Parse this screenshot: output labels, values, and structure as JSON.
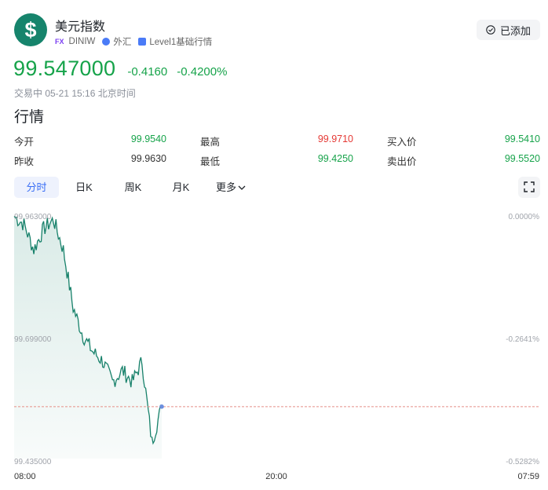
{
  "header": {
    "title": "美元指数",
    "market_tag": "FX",
    "symbol": "DINIW",
    "category": "外汇",
    "level": "Level1基础行情",
    "added_label": "已添加"
  },
  "quote": {
    "price": "99.547000",
    "change": "-0.4160",
    "change_pct": "-0.4200%",
    "status": "交易中 05-21 15:16 北京时间"
  },
  "section_title": "行情",
  "stats": {
    "open_label": "今开",
    "open": "99.9540",
    "high_label": "最高",
    "high": "99.9710",
    "bid_label": "买入价",
    "bid": "99.5410",
    "prev_close_label": "昨收",
    "prev_close": "99.9630",
    "low_label": "最低",
    "low": "99.4250",
    "ask_label": "卖出价",
    "ask": "99.5520"
  },
  "tabs": [
    {
      "label": "分时",
      "active": true
    },
    {
      "label": "日K",
      "active": false
    },
    {
      "label": "周K",
      "active": false
    },
    {
      "label": "月K",
      "active": false
    },
    {
      "label": "更多",
      "active": false
    }
  ],
  "chart_data": {
    "type": "area",
    "y_labels_left": [
      "99.963000",
      "99.699000",
      "99.435000"
    ],
    "y_labels_right": [
      "0.0000%",
      "-0.2641%",
      "-0.5282%"
    ],
    "x_labels": [
      "08:00",
      "20:00",
      "07:59"
    ],
    "ylim": [
      99.435,
      99.963
    ],
    "reference_line": 99.547,
    "line_color": "#17816a",
    "x": [
      "08:00",
      "08:30",
      "09:00",
      "09:30",
      "10:00",
      "10:30",
      "11:00",
      "11:30",
      "12:00",
      "12:30",
      "13:00",
      "13:30",
      "14:00",
      "14:30",
      "15:00",
      "15:16"
    ],
    "values": [
      99.957,
      99.94,
      99.885,
      99.93,
      99.95,
      99.885,
      99.76,
      99.7,
      99.665,
      99.645,
      99.6,
      99.625,
      99.6,
      99.645,
      99.47,
      99.547
    ]
  }
}
